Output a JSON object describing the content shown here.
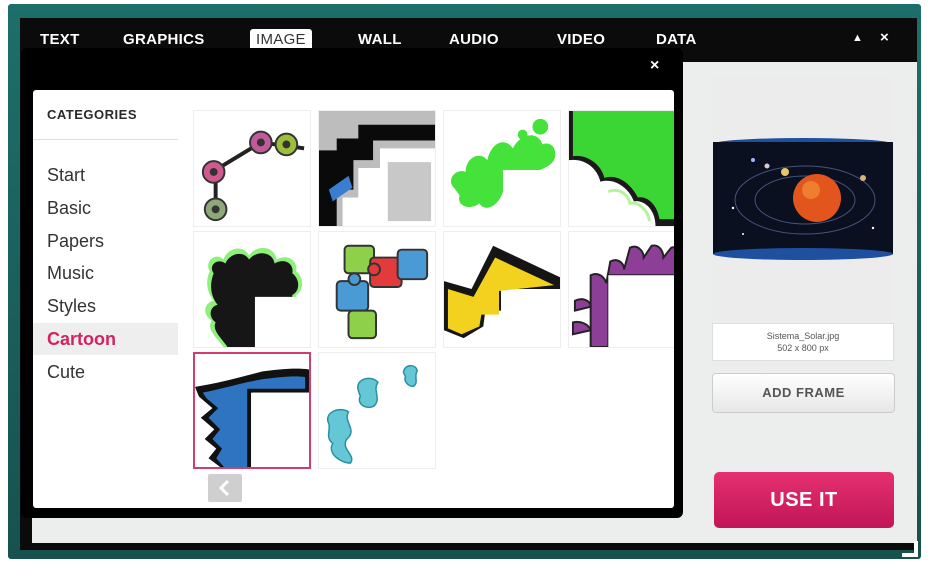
{
  "menu": {
    "items": [
      "TEXT",
      "GRAPHICS",
      "IMAGE",
      "WALL",
      "AUDIO",
      "VIDEO",
      "DATA"
    ],
    "active": "IMAGE",
    "controls": {
      "collapse": "▲",
      "close": "×"
    }
  },
  "dialog": {
    "close_label": "×",
    "categories": {
      "title": "CATEGORIES",
      "items": [
        "Start",
        "Basic",
        "Papers",
        "Music",
        "Styles",
        "Cartoon",
        "Cute"
      ],
      "active": "Cartoon"
    },
    "thumbnails": [
      "cartoon-buttons-chain",
      "cartoon-black-gray-corner",
      "cartoon-green-splat-corner",
      "cartoon-green-wave-corner",
      "cartoon-black-splat-corner",
      "cartoon-puzzle-pieces",
      "cartoon-yellow-zigzag-corner",
      "cartoon-purple-spikes-corner",
      "cartoon-blue-spikes-corner",
      "cartoon-blue-swirls-corner"
    ],
    "selected_thumbnail": "cartoon-blue-spikes-corner",
    "pager": {
      "prev_icon": "chevron-left-icon"
    }
  },
  "preview": {
    "file_name": "Sistema_Solar.jpg",
    "dimensions": "502 x 800 px",
    "add_frame_label": "ADD FRAME",
    "use_it_label": "USE IT"
  },
  "colors": {
    "frame_teal": "#1d6f6a",
    "accent_pink": "#d4235f",
    "use_it_button": "#d81f64"
  }
}
